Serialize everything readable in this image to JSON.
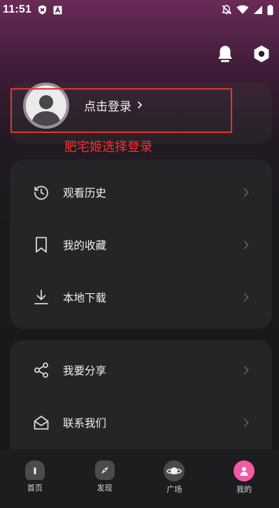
{
  "status_bar": {
    "time": "11:51"
  },
  "header": {
    "notification_icon": "bell-icon",
    "settings_icon": "hexagon-settings-icon"
  },
  "login": {
    "text": "点击登录",
    "chevron": "›"
  },
  "annotation": {
    "text": "肥宅姬选择登录",
    "color": "#ff2e2e"
  },
  "menu_group_1": {
    "items": [
      {
        "label": "观看历史",
        "icon": "history-icon"
      },
      {
        "label": "我的收藏",
        "icon": "bookmark-icon"
      },
      {
        "label": "本地下载",
        "icon": "download-icon"
      }
    ]
  },
  "menu_group_2": {
    "items": [
      {
        "label": "我要分享",
        "icon": "share-icon"
      },
      {
        "label": "联系我们",
        "icon": "mail-open-icon"
      }
    ]
  },
  "tab_bar": {
    "tabs": [
      {
        "label": "首页",
        "icon": "home-icon"
      },
      {
        "label": "发现",
        "icon": "compass-icon"
      },
      {
        "label": "广场",
        "icon": "planet-icon"
      },
      {
        "label": "我的",
        "icon": "user-icon",
        "active": true
      }
    ],
    "active_color": "#f25aa5"
  }
}
